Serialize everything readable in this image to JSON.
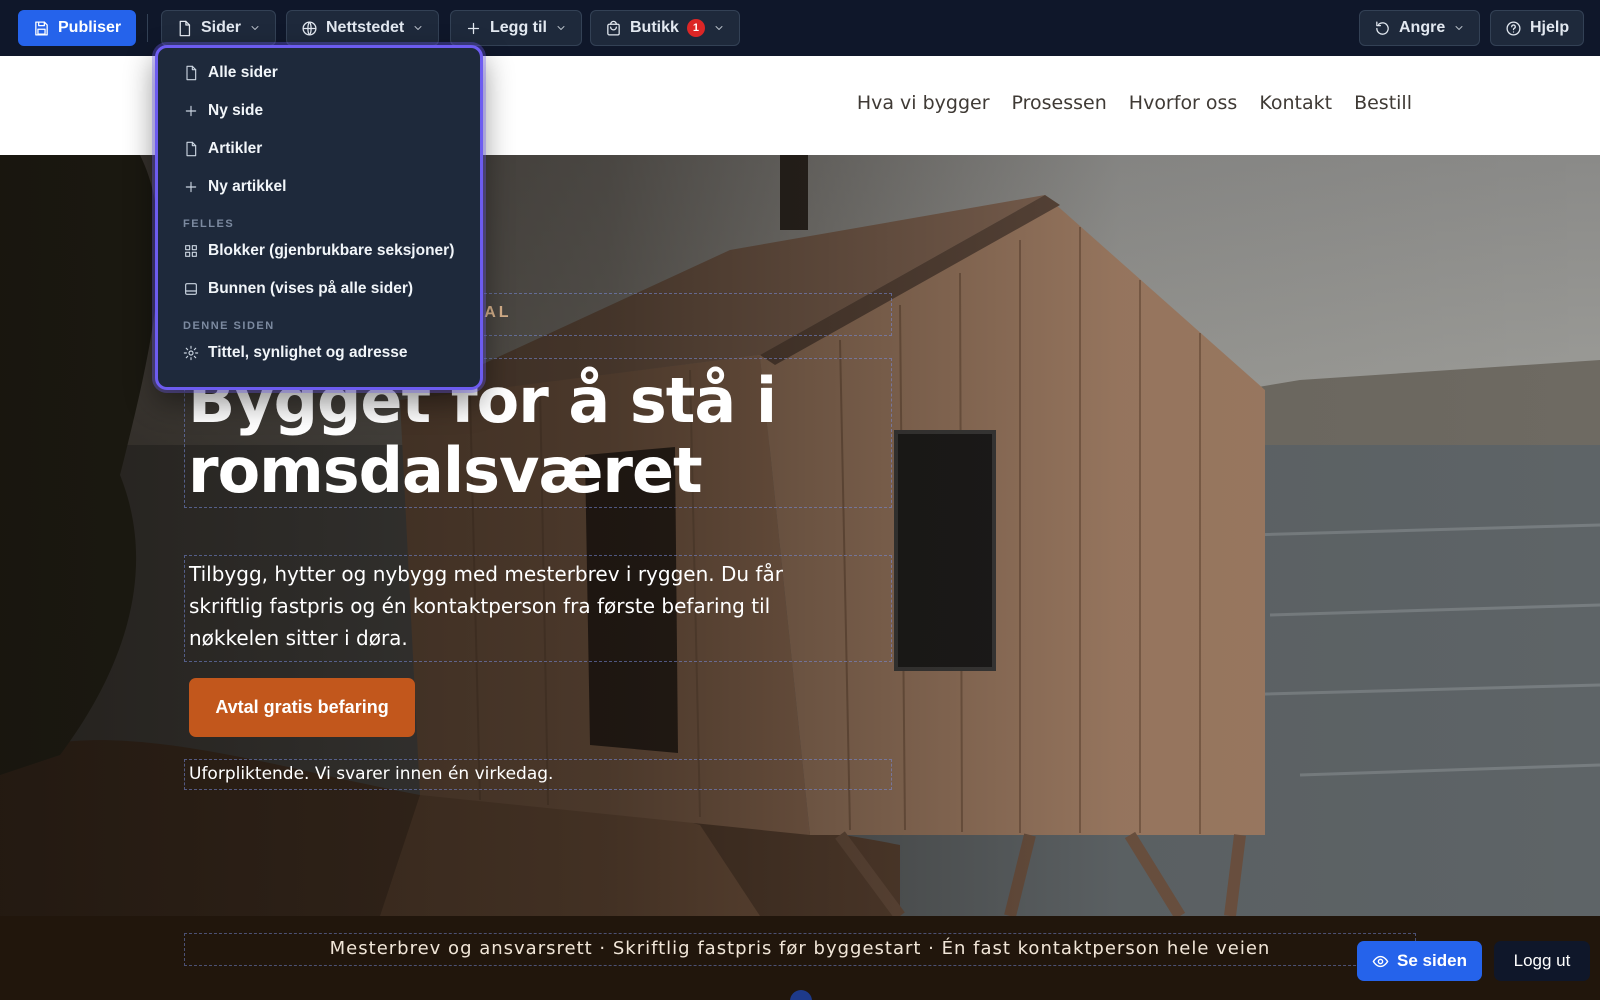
{
  "toolbar": {
    "publish_label": "Publiser",
    "pages_label": "Sider",
    "website_label": "Nettstedet",
    "add_label": "Legg til",
    "shop_label": "Butikk",
    "shop_badge": "1",
    "undo_label": "Angre",
    "help_label": "Hjelp"
  },
  "pages_menu": {
    "items": [
      {
        "label": "Alle sider",
        "icon": "page-icon"
      },
      {
        "label": "Ny side",
        "icon": "plus-icon"
      },
      {
        "label": "Artikler",
        "icon": "page-icon"
      },
      {
        "label": "Ny artikkel",
        "icon": "plus-icon"
      }
    ],
    "shared_heading": "FELLES",
    "shared_items": [
      {
        "label": "Blokker (gjenbrukbare seksjoner)",
        "icon": "grid-icon"
      },
      {
        "label": "Bunnen (vises på alle sider)",
        "icon": "footer-layout-icon"
      }
    ],
    "this_page_heading": "DENNE SIDEN",
    "this_page_items": [
      {
        "label": "Tittel, synlighet og adresse",
        "icon": "gear-icon"
      }
    ]
  },
  "site_nav": [
    "Hva vi bygger",
    "Prosessen",
    "Hvorfor oss",
    "Kontakt",
    "Bestill"
  ],
  "hero": {
    "eyebrow_visible": "SDAL",
    "title": "Bygget for å stå i romsdalsværet",
    "lead": "Tilbygg, hytter og nybygg med mesterbrev i ryggen. Du får skriftlig fastpris og én kontaktperson fra første befaring til nøkkelen sitter i døra.",
    "cta": "Avtal gratis befaring",
    "note": "Uforpliktende. Vi svarer innen én virkedag."
  },
  "trust_bar": {
    "text": "Mesterbrev og ansvarsrett  ·  Skriftlig fastpris før byggestart  ·  Én fast kontaktperson hele veien"
  },
  "floating": {
    "view_label": "Se siden",
    "logout_label": "Logg ut"
  },
  "colors": {
    "toolbar_bg": "#0f172a",
    "primary": "#2563eb",
    "cta": "#c2571c",
    "dropdown_border": "#6d5cf0"
  }
}
